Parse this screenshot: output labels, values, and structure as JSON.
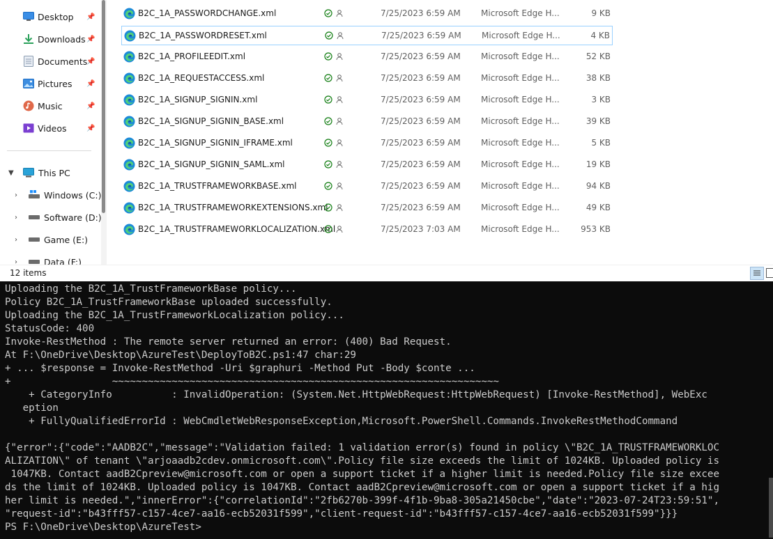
{
  "nav": {
    "quick_access": [
      {
        "label": "Desktop",
        "icon": "desktop-icon"
      },
      {
        "label": "Downloads",
        "icon": "downloads-icon"
      },
      {
        "label": "Documents",
        "icon": "documents-icon"
      },
      {
        "label": "Pictures",
        "icon": "pictures-icon"
      },
      {
        "label": "Music",
        "icon": "music-icon"
      },
      {
        "label": "Videos",
        "icon": "videos-icon"
      }
    ],
    "this_pc": "This PC",
    "drives": [
      {
        "label": "Windows (C:)"
      },
      {
        "label": "Software (D:)"
      },
      {
        "label": "Game (E:)"
      },
      {
        "label": "Data (F:)"
      }
    ]
  },
  "files": [
    {
      "name": "B2C_1A_PASSWORDCHANGE.xml",
      "date": "7/25/2023 6:59 AM",
      "type": "Microsoft Edge H...",
      "size": "9 KB"
    },
    {
      "name": "B2C_1A_PASSWORDRESET.xml",
      "date": "7/25/2023 6:59 AM",
      "type": "Microsoft Edge H...",
      "size": "4 KB",
      "selected": true
    },
    {
      "name": "B2C_1A_PROFILEEDIT.xml",
      "date": "7/25/2023 6:59 AM",
      "type": "Microsoft Edge H...",
      "size": "52 KB"
    },
    {
      "name": "B2C_1A_REQUESTACCESS.xml",
      "date": "7/25/2023 6:59 AM",
      "type": "Microsoft Edge H...",
      "size": "38 KB"
    },
    {
      "name": "B2C_1A_SIGNUP_SIGNIN.xml",
      "date": "7/25/2023 6:59 AM",
      "type": "Microsoft Edge H...",
      "size": "3 KB"
    },
    {
      "name": "B2C_1A_SIGNUP_SIGNIN_BASE.xml",
      "date": "7/25/2023 6:59 AM",
      "type": "Microsoft Edge H...",
      "size": "39 KB"
    },
    {
      "name": "B2C_1A_SIGNUP_SIGNIN_IFRAME.xml",
      "date": "7/25/2023 6:59 AM",
      "type": "Microsoft Edge H...",
      "size": "5 KB"
    },
    {
      "name": "B2C_1A_SIGNUP_SIGNIN_SAML.xml",
      "date": "7/25/2023 6:59 AM",
      "type": "Microsoft Edge H...",
      "size": "19 KB"
    },
    {
      "name": "B2C_1A_TRUSTFRAMEWORKBASE.xml",
      "date": "7/25/2023 6:59 AM",
      "type": "Microsoft Edge H...",
      "size": "94 KB"
    },
    {
      "name": "B2C_1A_TRUSTFRAMEWORKEXTENSIONS.xml",
      "date": "7/25/2023 6:59 AM",
      "type": "Microsoft Edge H...",
      "size": "49 KB"
    },
    {
      "name": "B2C_1A_TRUSTFRAMEWORKLOCALIZATION.xml",
      "date": "7/25/2023 7:03 AM",
      "type": "Microsoft Edge H...",
      "size": "953 KB"
    }
  ],
  "status": {
    "count": "12 items"
  },
  "terminal": {
    "lines": [
      "Uploading the B2C_1A_TrustFrameworkBase policy...",
      "Policy B2C_1A_TrustFrameworkBase uploaded successfully.",
      "Uploading the B2C_1A_TrustFrameworkLocalization policy...",
      "StatusCode: 400",
      "Invoke-RestMethod : The remote server returned an error: (400) Bad Request.",
      "At F:\\OneDrive\\Desktop\\AzureTest\\DeployToB2C.ps1:47 char:29",
      "+ ... $response = Invoke-RestMethod -Uri $graphuri -Method Put -Body $conte ...",
      "+                 ~~~~~~~~~~~~~~~~~~~~~~~~~~~~~~~~~~~~~~~~~~~~~~~~~~~~~~~~~~~~~~~~~",
      "    + CategoryInfo          : InvalidOperation: (System.Net.HttpWebRequest:HttpWebRequest) [Invoke-RestMethod], WebExc",
      "   eption",
      "    + FullyQualifiedErrorId : WebCmdletWebResponseException,Microsoft.PowerShell.Commands.InvokeRestMethodCommand",
      "",
      "{\"error\":{\"code\":\"AADB2C\",\"message\":\"Validation failed: 1 validation error(s) found in policy \\\"B2C_1A_TRUSTFRAMEWORKLOC",
      "ALIZATION\\\" of tenant \\\"arjoaadb2cdev.onmicrosoft.com\\\".Policy file size exceeds the limit of 1024KB. Uploaded policy is",
      " 1047KB. Contact aadB2Cpreview@microsoft.com or open a support ticket if a higher limit is needed.Policy file size excee",
      "ds the limit of 1024KB. Uploaded policy is 1047KB. Contact aadB2Cpreview@microsoft.com or open a support ticket if a hig",
      "her limit is needed.\",\"innerError\":{\"correlationId\":\"2fb6270b-399f-4f1b-9ba8-305a21450cbe\",\"date\":\"2023-07-24T23:59:51\",",
      "\"request-id\":\"b43fff57-c157-4ce7-aa16-ecb52031f599\",\"client-request-id\":\"b43fff57-c157-4ce7-aa16-ecb52031f599\"}}}",
      "PS F:\\OneDrive\\Desktop\\AzureTest>"
    ]
  }
}
